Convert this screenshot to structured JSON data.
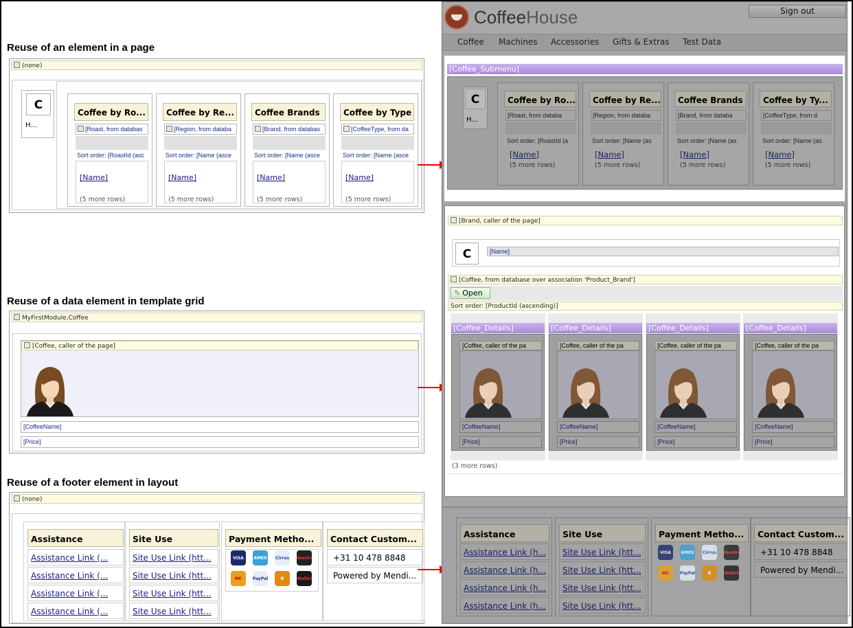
{
  "headings": {
    "a": "Reuse of an element in a page",
    "b": "Reuse of a data element in template grid",
    "c": "Reuse of a footer element in layout"
  },
  "left_a": {
    "bar": "(none)",
    "c_letter": "C",
    "h_text": "H...",
    "cards": [
      {
        "title": "Coffee by Ro...",
        "source": "[Roast, from databas",
        "sort": "Sort order: [RoastId (asc",
        "name": "[Name]",
        "more": "(5 more rows)"
      },
      {
        "title": "Coffee by Re...",
        "source": "[Region, from databa",
        "sort": "Sort order: [Name (asce",
        "name": "[Name]",
        "more": "(5 more rows)"
      },
      {
        "title": "Coffee Brands",
        "source": "[Brand, from databas",
        "sort": "Sort order: [Name (asce",
        "name": "[Name]",
        "more": "(5 more rows)"
      },
      {
        "title": "Coffee by Type",
        "source": "[CoffeeType, from da",
        "sort": "Sort order: [Name (asce",
        "name": "[Name]",
        "more": "(5 more rows)"
      }
    ]
  },
  "left_b": {
    "bar": "MyFirstModule.Coffee",
    "source": "[Coffee, caller of the page]",
    "f1": "[CoffeeName]",
    "f2": "[Price]"
  },
  "left_c": {
    "bar": "(none)",
    "cols": [
      {
        "title": "Assistance",
        "links": [
          "Assistance Link (...",
          "Assistance Link (...",
          "Assistance Link (...",
          "Assistance Link (..."
        ]
      },
      {
        "title": "Site Use",
        "links": [
          "Site Use Link (htt...",
          "Site Use Link (htt...",
          "Site Use Link (htt...",
          "Site Use Link (htt..."
        ]
      },
      {
        "title": "Payment Metho...",
        "links": []
      },
      {
        "title": "Contact Custom...",
        "lines": [
          "+31 10 478 8848",
          "Powered by Mendi..."
        ]
      }
    ]
  },
  "payments": [
    "VISA",
    "AMEX",
    "Cirrus",
    "Maestro",
    "MC",
    "PayPal",
    "B",
    "Wallet"
  ],
  "right_header": {
    "logo_a": "Coffee",
    "logo_b": "House",
    "signout": "Sign out",
    "nav": [
      "Coffee",
      "Machines",
      "Accessories",
      "Gifts & Extras",
      "Test Data"
    ]
  },
  "right_a": {
    "submenu": "[Coffee_Submenu]",
    "c_letter": "C",
    "h_text": "H...",
    "cards": [
      {
        "title": "Coffee by Ro...",
        "source": "[Roast, from databa",
        "sort": "Sort order: [RoastId (a",
        "name": "[Name]",
        "more": "(5 more rows)"
      },
      {
        "title": "Coffee by Re...",
        "source": "[Region, from databa",
        "sort": "Sort order: [Name (as",
        "name": "[Name]",
        "more": "(5 more rows)"
      },
      {
        "title": "Coffee Brands",
        "source": "[Brand, from databa",
        "sort": "Sort order: [Name (as",
        "name": "[Name]",
        "more": "(5 more rows)"
      },
      {
        "title": "Coffee by Ty...",
        "source": "[CoffeeType, from d",
        "sort": "Sort order: [Name (as",
        "name": "[Name]",
        "more": "(5 more rows)"
      }
    ]
  },
  "right_b": {
    "bar1": "[Brand, caller of the page]",
    "c_letter": "C",
    "name_field": "[Name]",
    "bar2": "[Coffee, from database over association 'Product_Brand']",
    "open": "Open",
    "sort": "Sort order: [ProductId (ascending)]",
    "details": [
      {
        "header": "[Coffee_Details]",
        "source": "[Coffee, caller of the pa",
        "f1": "[CoffeeName]",
        "f2": "[Price]"
      },
      {
        "header": "[Coffee_Details]",
        "source": "[Coffee, caller of the pa",
        "f1": "[CoffeeName]",
        "f2": "[Price]"
      },
      {
        "header": "[Coffee_Details]",
        "source": "[Coffee, caller of the pa",
        "f1": "[CoffeeName]",
        "f2": "[Price]"
      },
      {
        "header": "[Coffee_Details]",
        "source": "[Coffee, caller of the pa",
        "f1": "[CoffeeName]",
        "f2": "[Price]"
      }
    ],
    "more": "(3 more rows)"
  },
  "right_c": {
    "cols": [
      {
        "title": "Assistance",
        "links": [
          "Assistance Link (h...",
          "Assistance Link (h...",
          "Assistance Link (h...",
          "Assistance Link (h..."
        ]
      },
      {
        "title": "Site Use",
        "links": [
          "Site Use Link (htt...",
          "Site Use Link (htt...",
          "Site Use Link (htt...",
          "Site Use Link (htt..."
        ]
      },
      {
        "title": "Payment Metho...",
        "links": []
      },
      {
        "title": "Contact Custom...",
        "lines": [
          "+31 10 478 8848",
          "Powered by Mendi..."
        ]
      }
    ]
  }
}
